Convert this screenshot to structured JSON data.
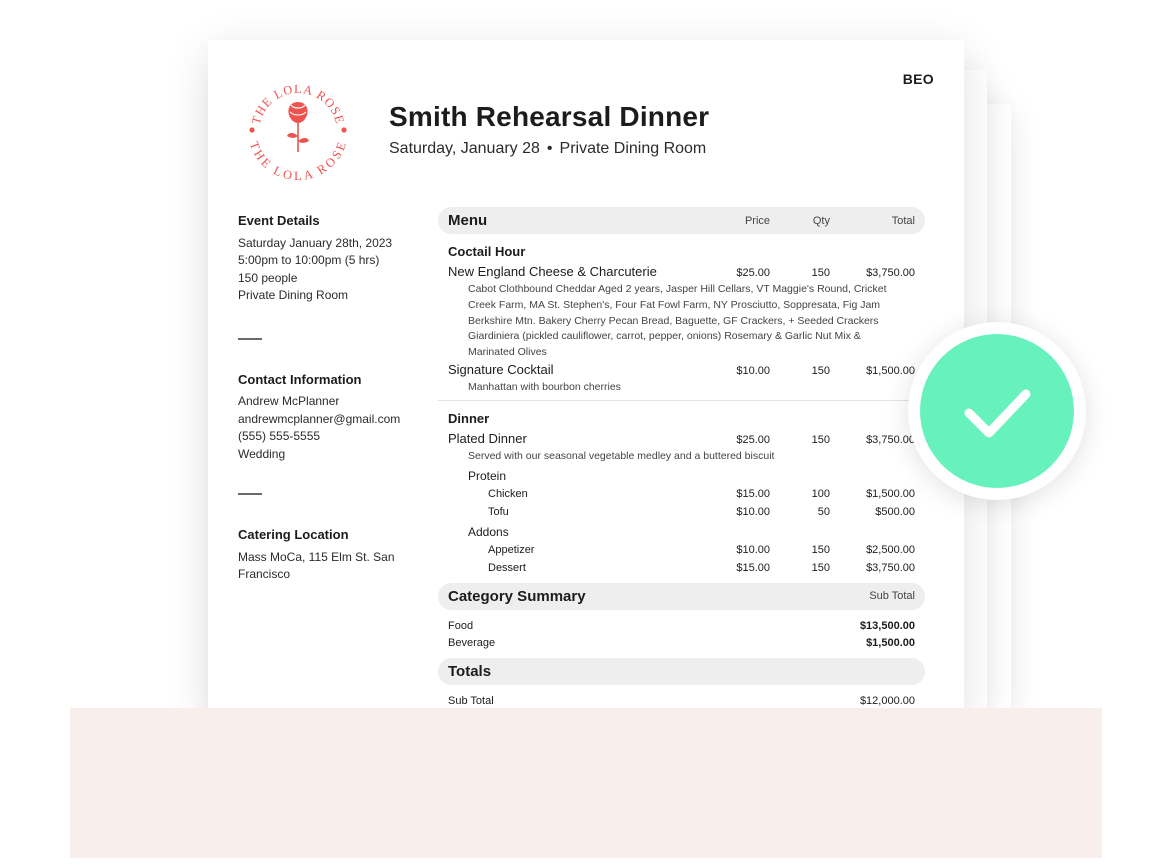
{
  "document": {
    "tag": "BEO",
    "title": "Smith Rehearsal Dinner",
    "subtitle_date": "Saturday, January 28",
    "subtitle_separator": "•",
    "subtitle_room": "Private Dining Room"
  },
  "logo": {
    "name": "THE LOLA ROSE",
    "icon": "rose-icon",
    "color": "#ef5350"
  },
  "event_details": {
    "title": "Event Details",
    "lines": [
      "Saturday January 28th, 2023",
      "5:00pm to 10:00pm (5 hrs)",
      "150 people",
      "Private Dining Room"
    ]
  },
  "contact": {
    "title": "Contact Information",
    "lines": [
      "Andrew McPlanner",
      "andrewmcplanner@gmail.com",
      "(555) 555-5555",
      "Wedding"
    ]
  },
  "catering": {
    "title": "Catering Location",
    "lines": [
      "Mass MoCa, 115 Elm St. San",
      "Francisco"
    ]
  },
  "menu": {
    "title": "Menu",
    "headers": {
      "price": "Price",
      "qty": "Qty",
      "total": "Total"
    },
    "cocktail": {
      "title": "Coctail Hour",
      "items": [
        {
          "name": "New England Cheese & Charcuterie",
          "price": "$25.00",
          "qty": "150",
          "total": "$3,750.00",
          "desc": [
            "Cabot Clothbound Cheddar Aged 2 years, Jasper Hill Cellars, VT Maggie's Round, Cricket",
            "Creek Farm, MA St. Stephen's, Four Fat Fowl Farm, NY Prosciutto, Soppresata, Fig Jam",
            "Berkshire Mtn. Bakery Cherry Pecan Bread, Baguette, GF Crackers, + Seeded Crackers",
            "Giardiniera (pickled cauliflower, carrot, pepper, onions) Rosemary & Garlic Nut Mix &",
            "Marinated Olives"
          ]
        },
        {
          "name": "Signature Cocktail",
          "price": "$10.00",
          "qty": "150",
          "total": "$1,500.00",
          "desc": [
            "Manhattan with bourbon cherries"
          ]
        }
      ]
    },
    "dinner": {
      "title": "Dinner",
      "item": {
        "name": "Plated Dinner",
        "price": "$25.00",
        "qty": "150",
        "total": "$3,750.00",
        "desc": "Served with our seasonal vegetable medley and a buttered biscuit"
      },
      "protein": {
        "title": "Protein",
        "rows": [
          {
            "name": "Chicken",
            "price": "$15.00",
            "qty": "100",
            "total": "$1,500.00"
          },
          {
            "name": "Tofu",
            "price": "$10.00",
            "qty": "50",
            "total": "$500.00"
          }
        ]
      },
      "addons": {
        "title": "Addons",
        "rows": [
          {
            "name": "Appetizer",
            "price": "$10.00",
            "qty": "150",
            "total": "$2,500.00"
          },
          {
            "name": "Dessert",
            "price": "$15.00",
            "qty": "150",
            "total": "$3,750.00"
          }
        ]
      }
    }
  },
  "category_summary": {
    "title": "Category Summary",
    "header": "Sub Total",
    "rows": [
      {
        "name": "Food",
        "value": "$13,500.00"
      },
      {
        "name": "Beverage",
        "value": "$1,500.00"
      }
    ]
  },
  "totals": {
    "title": "Totals",
    "rows": [
      {
        "name": "Sub Total",
        "value": "$12,000.00"
      }
    ]
  },
  "badge": {
    "icon": "checkmark-icon",
    "color": "#67f2bd"
  },
  "colors": {
    "accent": "#ef5350",
    "success": "#67f2bd",
    "panel": "#f8eeeb"
  }
}
